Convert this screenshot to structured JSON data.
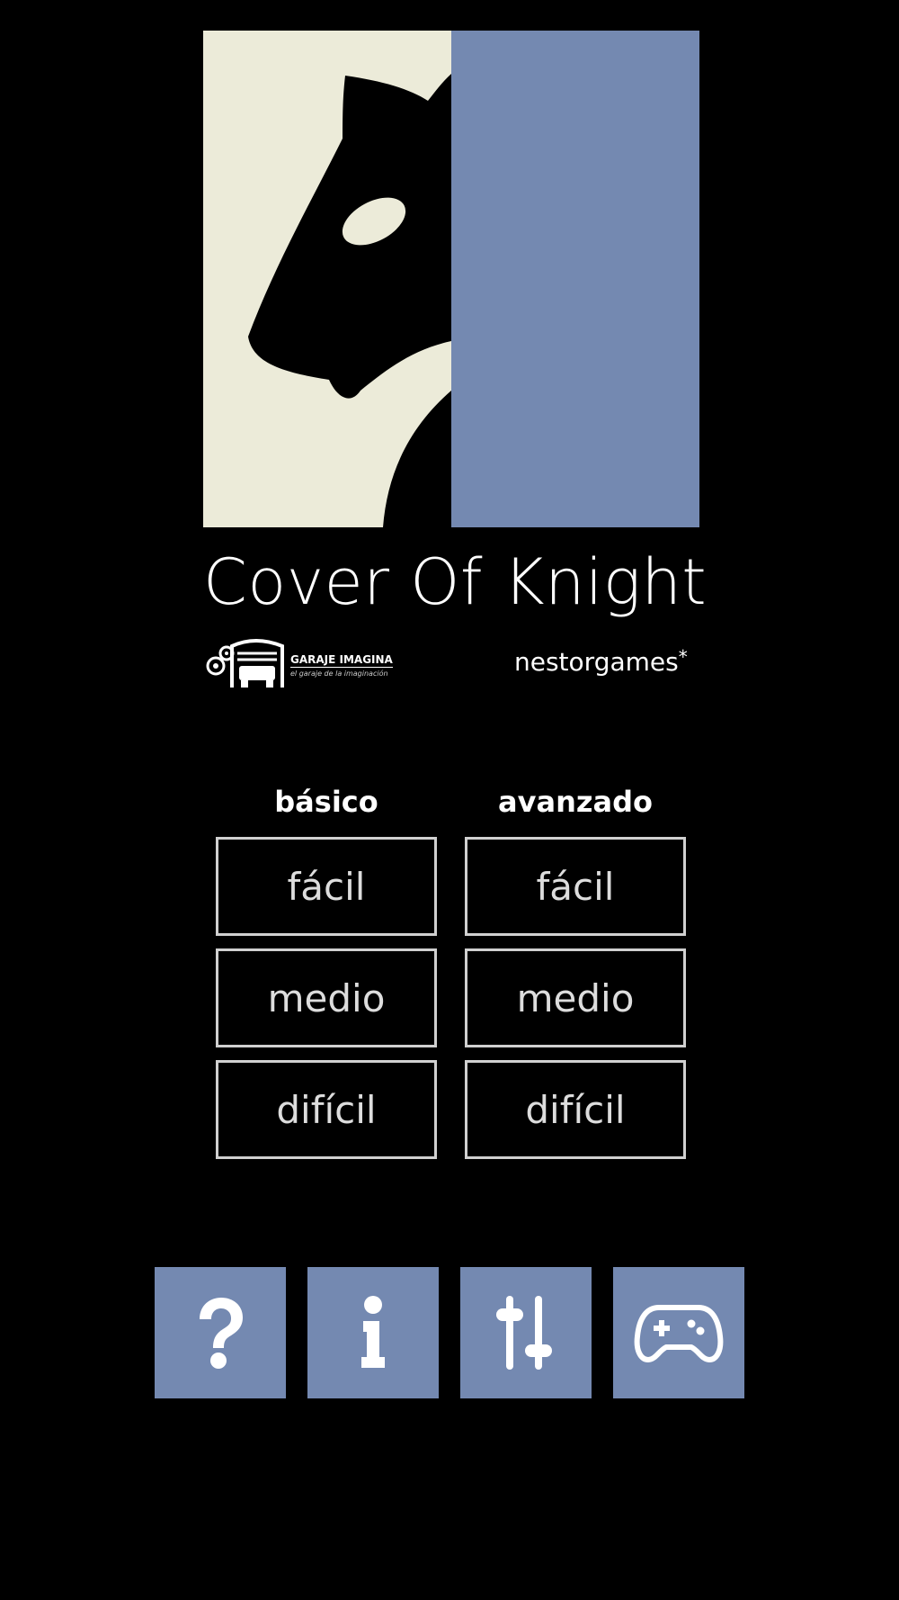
{
  "title": "Cover Of Knight",
  "colors": {
    "background": "#000000",
    "cover_cream": "#ecebd9",
    "cover_blue": "#7489b1",
    "button_border": "#d0d0d0",
    "button_text": "#dddddd",
    "icon_button": "#7489b1"
  },
  "logos": {
    "garaje_name": "GARAJE IMAGINA",
    "garaje_tagline": "el garaje de la imaginación",
    "nestorgames": "nestorgames",
    "nestorgames_mark": "*"
  },
  "modes": [
    {
      "header": "básico",
      "levels": [
        "fácil",
        "medio",
        "difícil"
      ]
    },
    {
      "header": "avanzado",
      "levels": [
        "fácil",
        "medio",
        "difícil"
      ]
    }
  ],
  "bottom_buttons": [
    {
      "icon": "help-icon"
    },
    {
      "icon": "info-icon"
    },
    {
      "icon": "settings-sliders-icon"
    },
    {
      "icon": "gamepad-icon"
    }
  ]
}
